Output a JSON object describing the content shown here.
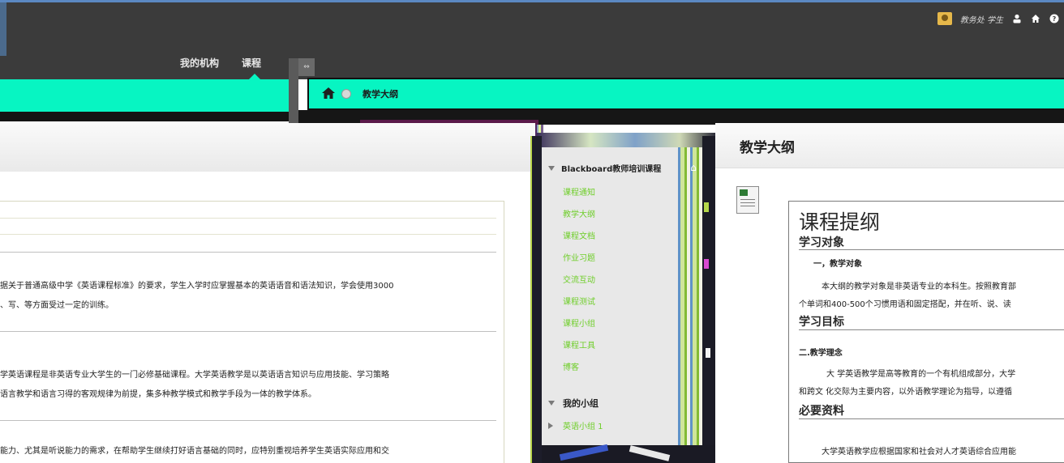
{
  "header": {
    "user_name": "教务处 学生",
    "user_icon": "user-avatar-icon",
    "icons": [
      "person-icon",
      "home-icon",
      "help-icon"
    ],
    "tabs": [
      {
        "label": "我的机构",
        "active": false
      },
      {
        "label": "课程",
        "active": true
      }
    ],
    "accent_color": "#07f5c2"
  },
  "breadcrumb": {
    "home_icon": "home-icon",
    "current": "教学大纲"
  },
  "left_content": {
    "para1_line1": "据关于普通高级中学《英语课程标准》的要求，学生入学时应掌握基本的英语语音和语法知识，学会使用3000",
    "para1_line2": "、写、等方面受过一定的训练。",
    "para2_line1": "学英语课程是非英语专业大学生的一门必修基础课程。大学英语教学是以英语语言知识与应用技能、学习策略",
    "para2_line2": "语言教学和语言习得的客观规律为前提，集多种教学模式和教学手段为一体的教学体系。",
    "para3_line1": "能力、尤其是听说能力的需求，在帮助学生继续打好语言基础的同时，应特别重视培养学生英语实际应用和交"
  },
  "course_menu": {
    "course_title": "Blackboard教师培训课程",
    "items": [
      "课程通知",
      "教学大纲",
      "课程文档",
      "作业习题",
      "交流互动",
      "课程测试",
      "课程小组",
      "课程工具",
      "博客"
    ],
    "group_title": "我的小组",
    "group_items": [
      "英语小组 1"
    ]
  },
  "syllabus": {
    "page_title": "教学大纲",
    "doc_title": "课程提纲",
    "sec1_heading": "学习对象",
    "sec1_sub": "一，教学对象",
    "sec1_line1": "本大纲的教学对象是非英语专业的本科生。按照教育部",
    "sec1_line2": "个单词和400-500个习惯用语和固定搭配，并在听、说、读",
    "sec2_heading": "学习目标",
    "sec2_sub": "二.教学理念",
    "sec2_line1": "大 学英语教学是高等教育的一个有机组成部分，大学",
    "sec2_line2": "和跨文 化交际为主要内容，以外语教学理论为指导，以遵循",
    "sec3_heading": "必要资料",
    "sec3_line1": "大学英语教学应根据国家和社会对人才英语综合应用能"
  }
}
